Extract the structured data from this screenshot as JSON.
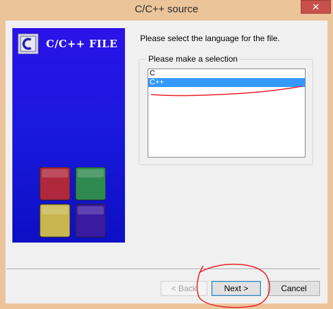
{
  "window": {
    "title": "C/C++ source",
    "close_glyph": "✕"
  },
  "banner": {
    "title": "C/C++ FILE",
    "logo_icon": "c-file-logo-icon",
    "logo_letter": "C",
    "cube_colors": [
      "#b0283c",
      "#2f8a50",
      "#c9b650",
      "#3a1aa0"
    ]
  },
  "main": {
    "prompt": "Please select the language for the file.",
    "group_label": "Please make a selection",
    "languages": [
      {
        "label": "C",
        "selected": false
      },
      {
        "label": "C++",
        "selected": true
      }
    ]
  },
  "buttons": {
    "back": "< Back",
    "next": "Next >",
    "cancel": "Cancel"
  },
  "colors": {
    "selection": "#3399ff",
    "banner_blue": "#1a19de",
    "annotation_red": "#e8202a"
  }
}
